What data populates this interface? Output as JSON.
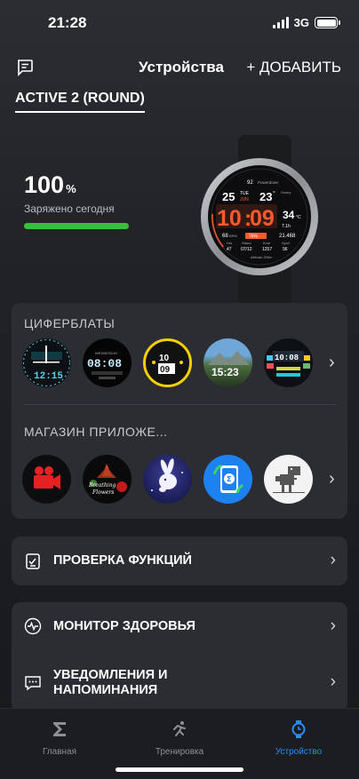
{
  "status": {
    "time": "21:28",
    "network": "3G"
  },
  "header": {
    "title": "Устройства",
    "add_label": "+ ДОБАВИТЬ",
    "chat_icon": "chat-icon"
  },
  "device": {
    "name": "ACTIVE 2 (ROUND)",
    "battery_value": "100",
    "battery_unit": "%",
    "battery_status": "Заряжено сегодня",
    "battery_level": 1.0,
    "battery_color": "#34c23a"
  },
  "watch_face": {
    "battery": "92",
    "brand": "Powerdown",
    "date_num": "25",
    "day": "TUE",
    "month": "JUN",
    "temp": "23",
    "temp_unit": "°",
    "weather": "Sunny",
    "time_h": "10",
    "time_m": "09",
    "right_val": "34",
    "right_unit": "°C",
    "hr": "68",
    "hr_unit": "BPM",
    "pct": "76%",
    "dist": "7.1h",
    "steps_right": "21.468",
    "labels": [
      "Hrs",
      "Stand",
      "Kcal",
      "Spo2"
    ],
    "values": [
      "47",
      "07/12",
      "1257",
      "96"
    ],
    "altitude": "Altitude 205m"
  },
  "faces": {
    "label": "ЦИФЕРБЛАТЫ",
    "items": [
      {
        "name": "face-teal-digital",
        "text": "12:15"
      },
      {
        "name": "face-white-digital",
        "text": "08:08",
        "sub": "WEDNESDAY"
      },
      {
        "name": "face-yellow-ring",
        "text": "10",
        "text2": "09"
      },
      {
        "name": "face-landscape",
        "text": "15:23"
      },
      {
        "name": "face-multicolor",
        "text": "10:08"
      }
    ]
  },
  "apps": {
    "label": "МАГАЗИН ПРИЛОЖЕ...",
    "items": [
      {
        "name": "camera-app",
        "icon": "video-camera-icon"
      },
      {
        "name": "breathing-app",
        "text": "Breathing Flowers"
      },
      {
        "name": "bunny-app",
        "icon": "rabbit-icon"
      },
      {
        "name": "sync-app",
        "icon": "watch-sync-icon"
      },
      {
        "name": "dino-app",
        "icon": "dinosaur-icon"
      }
    ]
  },
  "menu": {
    "check": "ПРОВЕРКА ФУНКЦИЙ",
    "health": "МОНИТОР ЗДОРОВЬЯ",
    "notifications": "УВЕДОМЛЕНИЯ И НАПОМИНАНИЯ"
  },
  "tabs": [
    {
      "label": "Главная",
      "icon": "sigma-icon"
    },
    {
      "label": "Тренировка",
      "icon": "running-icon"
    },
    {
      "label": "Устройство",
      "icon": "watch-icon",
      "active": true
    }
  ],
  "colors": {
    "accent": "#2c8ef4",
    "card": "#2b2d32",
    "watch_orange": "#ff5a2c"
  }
}
